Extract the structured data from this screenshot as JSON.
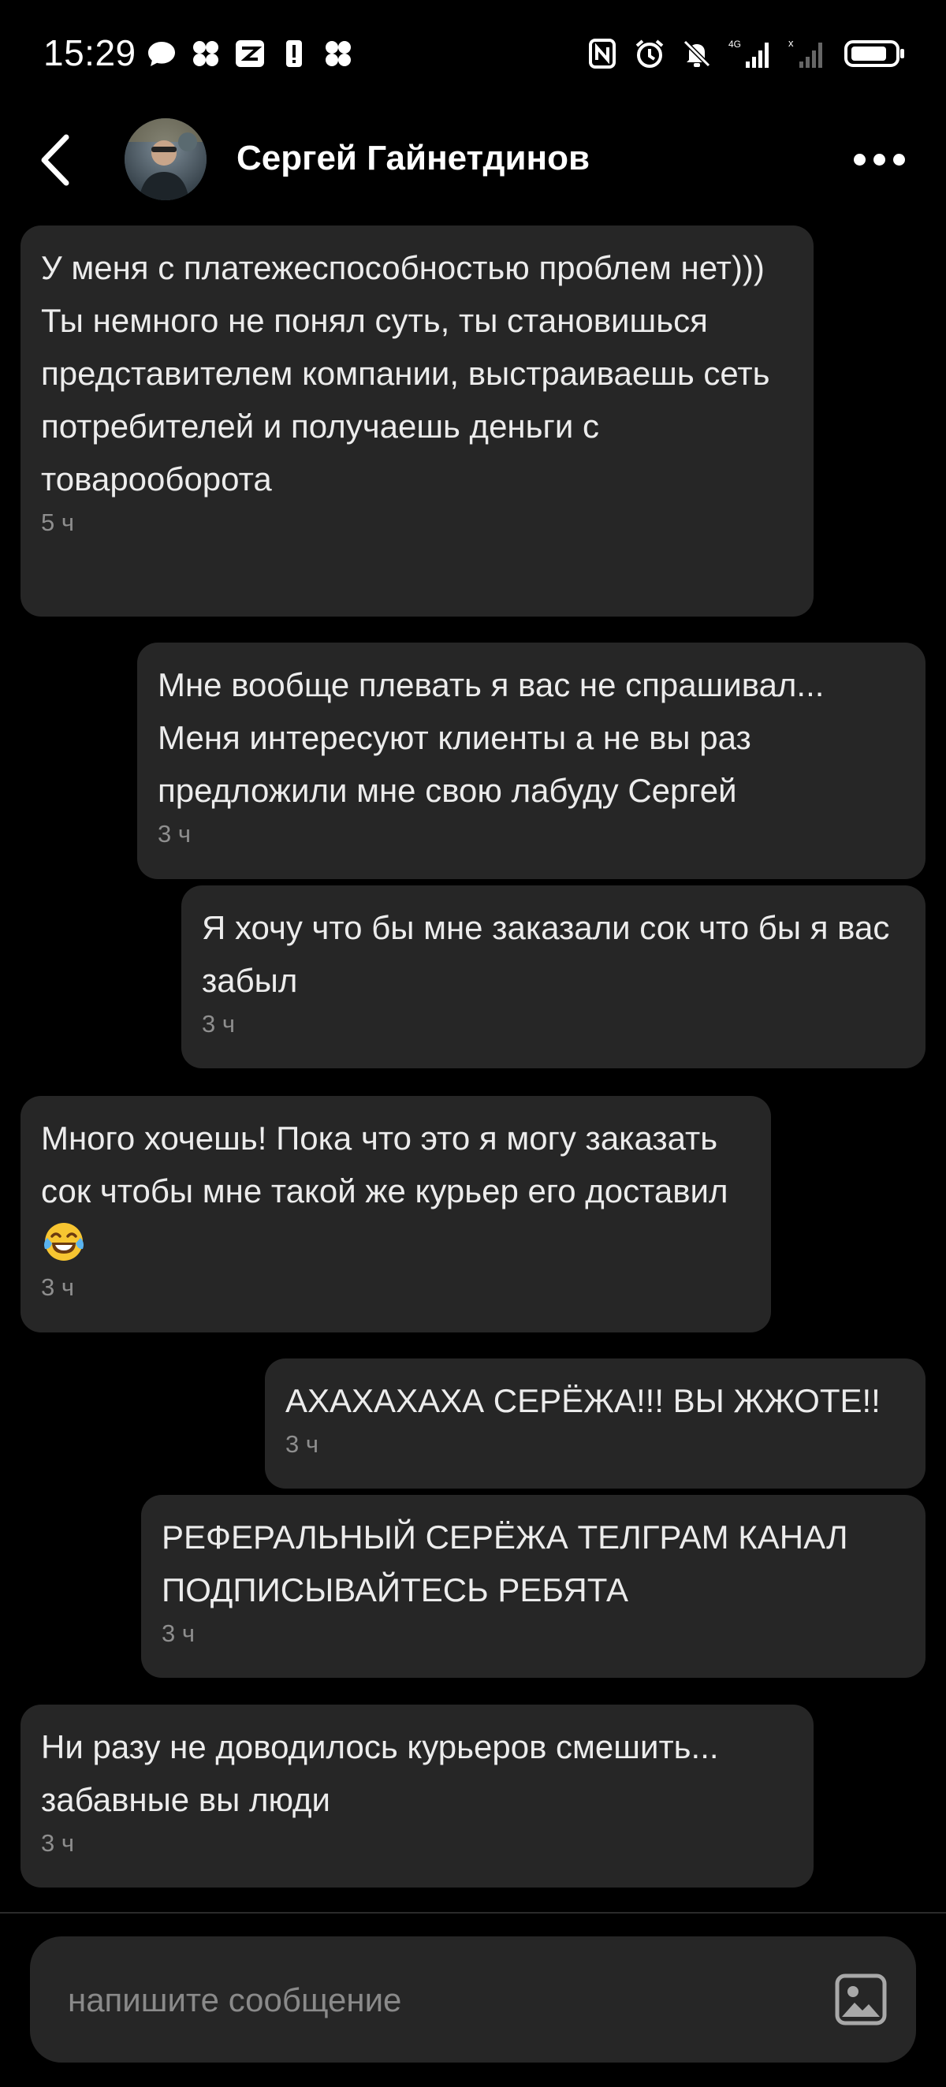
{
  "status_bar": {
    "time": "15:29"
  },
  "header": {
    "contact_name": "Сергей Гайнетдинов"
  },
  "messages": [
    {
      "side": "incoming",
      "text": "У меня с платежеспособностью проблем нет)))\nТы немного не понял суть, ты становишься представителем компании, выстраиваешь сеть потребителей и получаешь деньги с товарооборота",
      "time": "5 ч"
    },
    {
      "side": "outgoing",
      "text": "Мне вообще плевать я вас не спрашивал...\nМеня интересуют клиенты а не вы раз предложили мне свою лабуду Сергей",
      "time": "3 ч"
    },
    {
      "side": "outgoing",
      "text": "Я хочу что бы мне заказали сок что бы я вас забыл",
      "time": "3 ч"
    },
    {
      "side": "incoming",
      "text": "Много хочешь! Пока что это я могу заказать сок чтобы мне такой же курьер его доставил",
      "time": "3 ч",
      "emoji": "laughing-tears-emoji"
    },
    {
      "side": "outgoing",
      "text": "АХАХАХАХА СЕРЁЖА!!! ВЫ ЖЖОТЕ!!",
      "time": "3 ч"
    },
    {
      "side": "outgoing",
      "text": "РЕФЕРАЛЬНЫЙ СЕРЁЖА ТЕЛГРАМ КАНАЛ ПОДПИСЫВАЙТЕСЬ РЕБЯТА",
      "time": "3 ч"
    },
    {
      "side": "incoming",
      "text": "Ни разу не доводилось курьеров смешить...\nзабавные вы люди",
      "time": "3 ч"
    }
  ],
  "composer": {
    "placeholder": "напишите сообщение"
  },
  "colors": {
    "background": "#000000",
    "bubble": "#262626",
    "text": "#ececec",
    "time": "#8e8e8e"
  }
}
